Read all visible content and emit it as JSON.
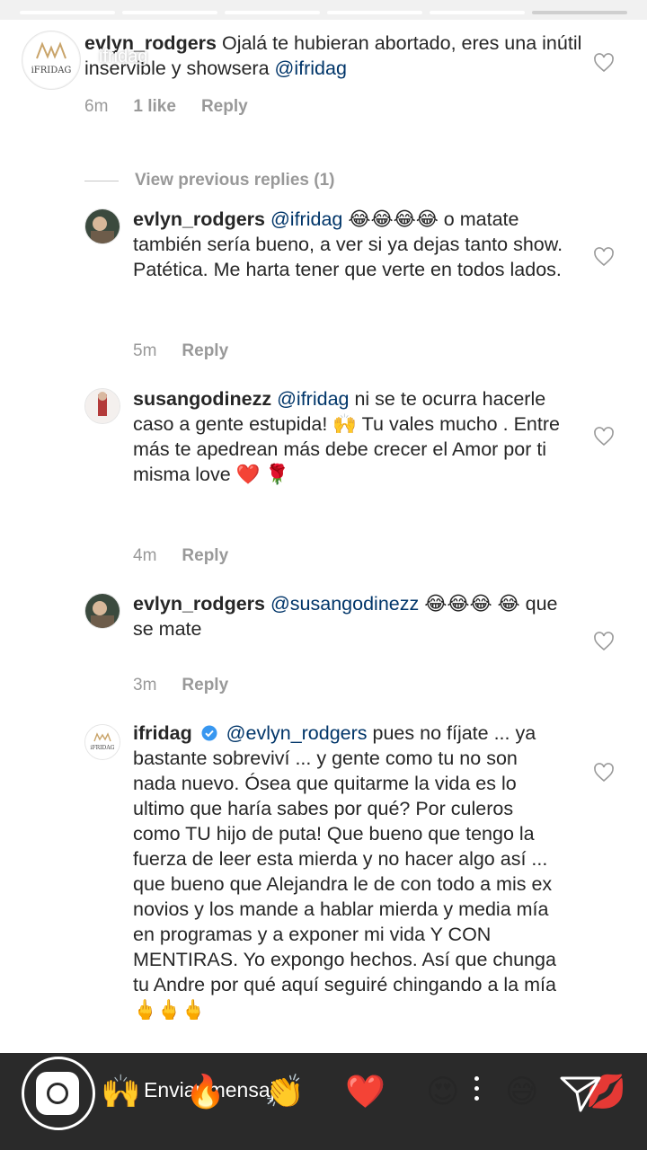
{
  "overlay": {
    "handle": "ifridag"
  },
  "view_previous": "View previous replies (1)",
  "comments": [
    {
      "username": "evlyn_rodgers",
      "text_parts": [
        "Ojalá te hubieran abortado, eres una inútil inservible y showsera ",
        "@ifridag"
      ],
      "time": "6m",
      "likes": "1 like",
      "reply": "Reply"
    },
    {
      "username": "evlyn_rodgers",
      "mention": "@ifridag",
      "text": " 😂😂😂😂 o matate también sería bueno, a ver si ya dejas tanto show. Patética. Me harta tener que verte en todos lados.",
      "time": "5m",
      "reply": "Reply"
    },
    {
      "username": "susangodinezz",
      "mention": "@ifridag",
      "text": " ni se te ocurra hacerle caso a gente estupida! 🙌 Tu vales mucho . Entre más te apedrean más debe crecer el Amor por ti misma love ❤️ 🌹",
      "time": "4m",
      "reply": "Reply"
    },
    {
      "username": "evlyn_rodgers",
      "mention": "@susangodinezz",
      "text": " 😂😂😂 😂 que se mate",
      "time": "3m",
      "reply": "Reply"
    },
    {
      "username": "ifridag",
      "mention": "@evlyn_rodgers",
      "text": " pues no fíjate ... ya bastante sobreviví ... y gente como tu no son nada nuevo. Ósea que quitarme la vida es lo ultimo que haría sabes por qué? Por culeros como TU hijo de puta! Que bueno que tengo la fuerza de leer esta mierda y no hacer algo así ... que bueno que Alejandra le de con todo a mis ex novios y los mande a hablar mierda y media mía en programas y a exponer mi vida Y CON MENTIRAS. Yo expongo hechos. Así que chunga tu Andre por qué aquí seguiré chingando a la mía 🖕🖕🖕"
    }
  ],
  "bottom_bar": {
    "placeholder": "Enviar mensaje",
    "reactions": [
      "🙌",
      "🔥",
      "👏",
      "❤️",
      "😍",
      "😅",
      "💋"
    ]
  },
  "colors": {
    "sheet": "#ffffff",
    "muted": "#999999",
    "text": "#262626",
    "mention": "#003569",
    "bar": "#2a2a2a"
  }
}
